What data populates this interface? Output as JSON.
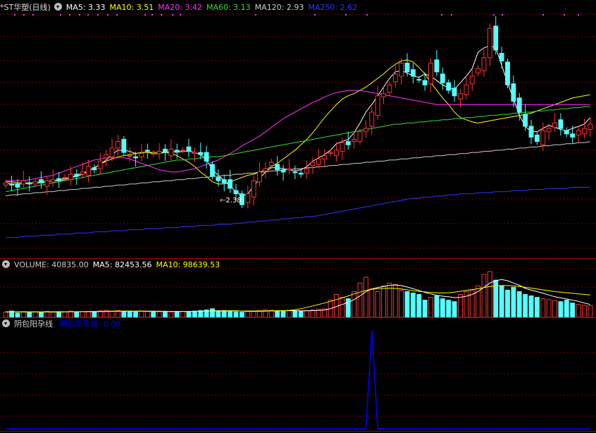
{
  "main_panel": {
    "title": "*ST华塑(日线)",
    "ma_labels": [
      {
        "name": "MA5",
        "text": "MA5: 3.33",
        "color": "#ffffff"
      },
      {
        "name": "MA10",
        "text": "MA10: 3.51",
        "color": "#ffff00"
      },
      {
        "name": "MA20",
        "text": "MA20: 3.42",
        "color": "#ff33ff"
      },
      {
        "name": "MA60",
        "text": "MA60: 3.13",
        "color": "#33dd33"
      },
      {
        "name": "MA120",
        "text": "MA120: 2.93",
        "color": "#cccccc"
      },
      {
        "name": "MA250",
        "text": "MA250: 2.62",
        "color": "#3333ff"
      }
    ],
    "low_marker": "2.38"
  },
  "volume_panel": {
    "labels": [
      {
        "name": "VOLUME",
        "text": "VOLUME: 40835.00",
        "color": "#cccccc"
      },
      {
        "name": "MA5",
        "text": "MA5: 82453.56",
        "color": "#ffffff"
      },
      {
        "name": "MA10",
        "text": "MA10: 98639.53",
        "color": "#ffff00"
      }
    ]
  },
  "indicator_panel": {
    "name": "阴包阳孕线",
    "value_text": "阴包阳孕线: 0.00",
    "color": "#0000ff"
  },
  "colors": {
    "up": "#ff3333",
    "down": "#55ffff",
    "grid": "#7a0000",
    "border": "#aa0000"
  },
  "chart_data": {
    "type": "candlestick",
    "title": "*ST华塑(日线)",
    "price_range": [
      2.1,
      4.25
    ],
    "candle_close_trace": [
      2.7,
      2.68,
      2.66,
      2.72,
      2.69,
      2.71,
      2.7,
      2.72,
      2.73,
      2.72,
      2.75,
      2.78,
      2.76,
      2.8,
      2.85,
      2.82,
      2.9,
      2.96,
      3.02,
      3.08,
      2.98,
      2.95,
      2.93,
      2.97,
      2.99,
      2.97,
      2.99,
      2.98,
      3.01,
      2.99,
      3.0,
      2.99,
      2.98,
      2.96,
      2.9,
      2.76,
      2.72,
      2.7,
      2.65,
      2.6,
      2.5,
      2.6,
      2.72,
      2.8,
      2.83,
      2.89,
      2.82,
      2.8,
      2.83,
      2.8,
      2.78,
      2.83,
      2.89,
      2.92,
      2.95,
      2.98,
      3.0,
      3.07,
      3.05,
      3.1,
      3.17,
      3.2,
      3.35,
      3.5,
      3.52,
      3.6,
      3.7,
      3.8,
      3.72,
      3.68,
      3.65,
      3.6,
      3.8,
      3.72,
      3.62,
      3.55,
      3.5,
      3.52,
      3.6,
      3.68,
      3.75,
      3.85,
      4.12,
      3.92,
      3.82,
      3.6,
      3.45,
      3.35,
      3.22,
      3.12,
      3.08,
      3.18,
      3.2,
      3.25,
      3.2,
      3.15,
      3.12,
      3.18,
      3.2,
      3.24
    ],
    "ma_series": {
      "MA5": [
        2.7,
        2.69,
        2.69,
        2.69,
        2.7,
        2.7,
        2.7,
        2.71,
        2.72,
        2.72,
        2.73,
        2.75,
        2.76,
        2.78,
        2.81,
        2.84,
        2.87,
        2.91,
        2.96,
        3.0,
        3.0,
        2.99,
        2.97,
        2.98,
        2.98,
        2.97,
        2.97,
        2.98,
        2.99,
        2.98,
        2.99,
        2.99,
        2.98,
        2.96,
        2.91,
        2.82,
        2.77,
        2.72,
        2.67,
        2.62,
        2.58,
        2.6,
        2.67,
        2.74,
        2.8,
        2.84,
        2.84,
        2.83,
        2.82,
        2.81,
        2.82,
        2.85,
        2.9,
        2.93,
        2.96,
        3.0,
        3.06,
        3.08,
        3.1,
        3.16,
        3.25,
        3.35,
        3.42,
        3.5,
        3.58,
        3.66,
        3.72,
        3.73,
        3.71,
        3.68,
        3.67,
        3.7,
        3.68,
        3.64,
        3.6,
        3.57,
        3.56,
        3.62,
        3.68,
        3.75,
        3.9,
        3.94,
        3.96,
        3.94,
        3.78,
        3.62,
        3.47,
        3.32,
        3.22,
        3.17,
        3.17,
        3.2,
        3.23,
        3.21,
        3.19,
        3.18,
        3.2,
        3.22,
        3.24,
        3.3
      ],
      "MA10": [
        2.71,
        2.71,
        2.7,
        2.7,
        2.7,
        2.7,
        2.71,
        2.71,
        2.72,
        2.73,
        2.74,
        2.75,
        2.77,
        2.79,
        2.81,
        2.84,
        2.87,
        2.9,
        2.92,
        2.94,
        2.95,
        2.96,
        2.97,
        2.98,
        2.98,
        2.98,
        2.98,
        2.98,
        2.97,
        2.95,
        2.92,
        2.89,
        2.85,
        2.8,
        2.76,
        2.71,
        2.69,
        2.69,
        2.71,
        2.73,
        2.75,
        2.77,
        2.78,
        2.8,
        2.82,
        2.85,
        2.88,
        2.92,
        2.96,
        3.0,
        3.05,
        3.1,
        3.16,
        3.23,
        3.3,
        3.36,
        3.42,
        3.47,
        3.5,
        3.52,
        3.55,
        3.58,
        3.62,
        3.66,
        3.7,
        3.75,
        3.79,
        3.82,
        3.83,
        3.81,
        3.76,
        3.7,
        3.62,
        3.55,
        3.48,
        3.42,
        3.35,
        3.3,
        3.28,
        3.26,
        3.25,
        3.26,
        3.27,
        3.28,
        3.29,
        3.3,
        3.31,
        3.32,
        3.33,
        3.34,
        3.36,
        3.38,
        3.4,
        3.42,
        3.44,
        3.46,
        3.48,
        3.49,
        3.5,
        3.51
      ],
      "MA20": [
        2.72,
        2.72,
        2.72,
        2.72,
        2.73,
        2.74,
        2.75,
        2.76,
        2.77,
        2.79,
        2.81,
        2.83,
        2.85,
        2.87,
        2.89,
        2.91,
        2.92,
        2.93,
        2.93,
        2.93,
        2.93,
        2.92,
        2.9,
        2.88,
        2.86,
        2.84,
        2.82,
        2.81,
        2.8,
        2.8,
        2.81,
        2.82,
        2.83,
        2.85,
        2.87,
        2.89,
        2.91,
        2.94,
        2.97,
        3.0,
        3.04,
        3.07,
        3.1,
        3.13,
        3.17,
        3.21,
        3.25,
        3.29,
        3.32,
        3.35,
        3.38,
        3.41,
        3.44,
        3.46,
        3.49,
        3.51,
        3.53,
        3.54,
        3.55,
        3.55,
        3.55,
        3.54,
        3.53,
        3.52,
        3.51,
        3.5,
        3.49,
        3.48,
        3.47,
        3.46,
        3.45,
        3.44,
        3.43,
        3.42,
        3.42,
        3.42,
        3.42,
        3.42,
        3.42,
        3.42,
        3.42,
        3.42,
        3.42,
        3.42,
        3.42,
        3.42,
        3.42,
        3.42,
        3.42,
        3.42,
        3.42,
        3.42,
        3.42,
        3.42,
        3.42,
        3.42,
        3.42,
        3.42,
        3.42,
        3.42
      ],
      "MA60": [
        2.62,
        2.63,
        2.64,
        2.65,
        2.66,
        2.67,
        2.68,
        2.69,
        2.7,
        2.71,
        2.72,
        2.73,
        2.74,
        2.75,
        2.76,
        2.77,
        2.78,
        2.79,
        2.8,
        2.81,
        2.82,
        2.83,
        2.84,
        2.85,
        2.86,
        2.87,
        2.88,
        2.89,
        2.9,
        2.91,
        2.91,
        2.92,
        2.92,
        2.93,
        2.93,
        2.94,
        2.94,
        2.95,
        2.96,
        2.97,
        2.98,
        2.99,
        3.0,
        3.01,
        3.02,
        3.03,
        3.04,
        3.05,
        3.06,
        3.07,
        3.08,
        3.09,
        3.1,
        3.11,
        3.12,
        3.13,
        3.14,
        3.15,
        3.16,
        3.17,
        3.18,
        3.19,
        3.2,
        3.21,
        3.22,
        3.23,
        3.24,
        3.24,
        3.25,
        3.25,
        3.26,
        3.26,
        3.27,
        3.27,
        3.28,
        3.28,
        3.29,
        3.29,
        3.3,
        3.3,
        3.31,
        3.31,
        3.32,
        3.32,
        3.33,
        3.33,
        3.34,
        3.34,
        3.35,
        3.35,
        3.36,
        3.36,
        3.37,
        3.37,
        3.38,
        3.38,
        3.39,
        3.39,
        3.4,
        3.4
      ],
      "MA120": [
        2.58,
        2.59,
        2.59,
        2.6,
        2.6,
        2.61,
        2.61,
        2.62,
        2.62,
        2.63,
        2.63,
        2.64,
        2.64,
        2.65,
        2.65,
        2.66,
        2.66,
        2.67,
        2.67,
        2.68,
        2.68,
        2.69,
        2.69,
        2.7,
        2.7,
        2.71,
        2.71,
        2.72,
        2.72,
        2.73,
        2.73,
        2.74,
        2.74,
        2.75,
        2.75,
        2.76,
        2.76,
        2.77,
        2.77,
        2.78,
        2.78,
        2.79,
        2.79,
        2.8,
        2.8,
        2.81,
        2.81,
        2.82,
        2.82,
        2.83,
        2.83,
        2.84,
        2.84,
        2.85,
        2.85,
        2.86,
        2.86,
        2.87,
        2.87,
        2.88,
        2.88,
        2.89,
        2.89,
        2.9,
        2.9,
        2.91,
        2.91,
        2.92,
        2.92,
        2.93,
        2.93,
        2.94,
        2.94,
        2.95,
        2.95,
        2.96,
        2.96,
        2.97,
        2.97,
        2.98,
        2.98,
        2.99,
        2.99,
        3.0,
        3.0,
        3.01,
        3.01,
        3.02,
        3.02,
        3.03,
        3.03,
        3.04,
        3.04,
        3.05,
        3.05,
        3.06,
        3.06,
        3.07,
        3.07,
        3.08
      ],
      "MA250": [
        2.2,
        2.2,
        2.2,
        2.21,
        2.21,
        2.21,
        2.22,
        2.22,
        2.22,
        2.23,
        2.23,
        2.23,
        2.24,
        2.24,
        2.24,
        2.25,
        2.25,
        2.25,
        2.26,
        2.26,
        2.26,
        2.27,
        2.27,
        2.27,
        2.28,
        2.28,
        2.28,
        2.29,
        2.29,
        2.29,
        2.3,
        2.3,
        2.3,
        2.31,
        2.31,
        2.31,
        2.32,
        2.32,
        2.32,
        2.33,
        2.33,
        2.34,
        2.34,
        2.35,
        2.35,
        2.36,
        2.36,
        2.37,
        2.37,
        2.38,
        2.38,
        2.39,
        2.39,
        2.4,
        2.41,
        2.42,
        2.43,
        2.44,
        2.45,
        2.46,
        2.47,
        2.48,
        2.49,
        2.5,
        2.51,
        2.52,
        2.53,
        2.54,
        2.55,
        2.56,
        2.56,
        2.57,
        2.57,
        2.58,
        2.58,
        2.59,
        2.59,
        2.6,
        2.6,
        2.6,
        2.61,
        2.61,
        2.61,
        2.62,
        2.62,
        2.62,
        2.63,
        2.63,
        2.63,
        2.64,
        2.64,
        2.64,
        2.65,
        2.65,
        2.65,
        2.65,
        2.66,
        2.66,
        2.66,
        2.66
      ]
    },
    "volume_trace": [
      18000,
      22000,
      15000,
      20000,
      17000,
      19000,
      16000,
      21000,
      18000,
      20000,
      19000,
      22000,
      18000,
      20000,
      21000,
      19000,
      23000,
      25000,
      22000,
      24000,
      20000,
      21000,
      19000,
      22000,
      20000,
      21000,
      19000,
      20000,
      18000,
      19000,
      21000,
      20000,
      22000,
      24000,
      26000,
      30000,
      22000,
      21000,
      20000,
      19000,
      18000,
      20000,
      22000,
      24000,
      26000,
      25000,
      22000,
      21000,
      23000,
      22000,
      21000,
      24000,
      26000,
      28000,
      30000,
      60000,
      80000,
      70000,
      65000,
      90000,
      120000,
      140000,
      100000,
      90000,
      110000,
      120000,
      115000,
      95000,
      90000,
      85000,
      80000,
      60000,
      70000,
      75000,
      65000,
      60000,
      55000,
      80000,
      90000,
      95000,
      110000,
      150000,
      160000,
      130000,
      110000,
      95000,
      105000,
      90000,
      80000,
      75000,
      70000,
      65000,
      62000,
      58000,
      55000,
      60000,
      50000,
      45000,
      42000,
      40835
    ],
    "volume_ma5": [
      19000,
      19200,
      19000,
      19100,
      19000,
      18900,
      18800,
      18900,
      19000,
      19200,
      19300,
      19500,
      19600,
      19700,
      19800,
      20000,
      20200,
      20500,
      21000,
      21500,
      21800,
      21900,
      21800,
      21900,
      21700,
      21500,
      21300,
      21200,
      20900,
      20700,
      20600,
      20500,
      20700,
      21000,
      21500,
      22500,
      23100,
      23300,
      23200,
      22700,
      22000,
      21300,
      21000,
      21100,
      21500,
      22300,
      23000,
      23300,
      23500,
      23300,
      22700,
      22700,
      23300,
      24300,
      25700,
      30000,
      38000,
      45000,
      52000,
      62000,
      75000,
      90000,
      99000,
      104000,
      108000,
      112000,
      113000,
      111000,
      106000,
      100000,
      94000,
      87000,
      82000,
      77000,
      74000,
      72000,
      69000,
      70000,
      74000,
      80000,
      90000,
      105000,
      120000,
      128000,
      132000,
      128000,
      120000,
      112000,
      101000,
      95000,
      90000,
      84000,
      78000,
      72000,
      68000,
      64000,
      60000,
      56000,
      50000,
      45000
    ],
    "volume_ma10": [
      19500,
      19500,
      19400,
      19300,
      19200,
      19200,
      19200,
      19300,
      19400,
      19500,
      19600,
      19800,
      20000,
      20200,
      20500,
      20700,
      21000,
      21200,
      21400,
      21500,
      21600,
      21600,
      21500,
      21400,
      21300,
      21200,
      21100,
      21000,
      20900,
      20800,
      20800,
      20900,
      21000,
      21200,
      21400,
      21700,
      22000,
      22200,
      22300,
      22300,
      22200,
      22100,
      22100,
      22200,
      22400,
      22700,
      23000,
      23500,
      24500,
      26500,
      30000,
      35000,
      40000,
      45000,
      50000,
      56000,
      62000,
      68000,
      75000,
      82000,
      88000,
      94000,
      98000,
      100000,
      101000,
      102000,
      101000,
      99000,
      96000,
      93000,
      91000,
      89000,
      87000,
      86000,
      85000,
      86000,
      88000,
      91000,
      94000,
      97000,
      100000,
      104000,
      108000,
      110000,
      111000,
      111000,
      110000,
      108000,
      105000,
      102000,
      99000,
      96000,
      93000,
      90000,
      88000,
      86000,
      84000,
      82000,
      80000,
      78000
    ],
    "indicator_series": {
      "name": "阴包阳孕线",
      "spike_index": 62,
      "spike_value": 1,
      "baseline": 0
    }
  }
}
